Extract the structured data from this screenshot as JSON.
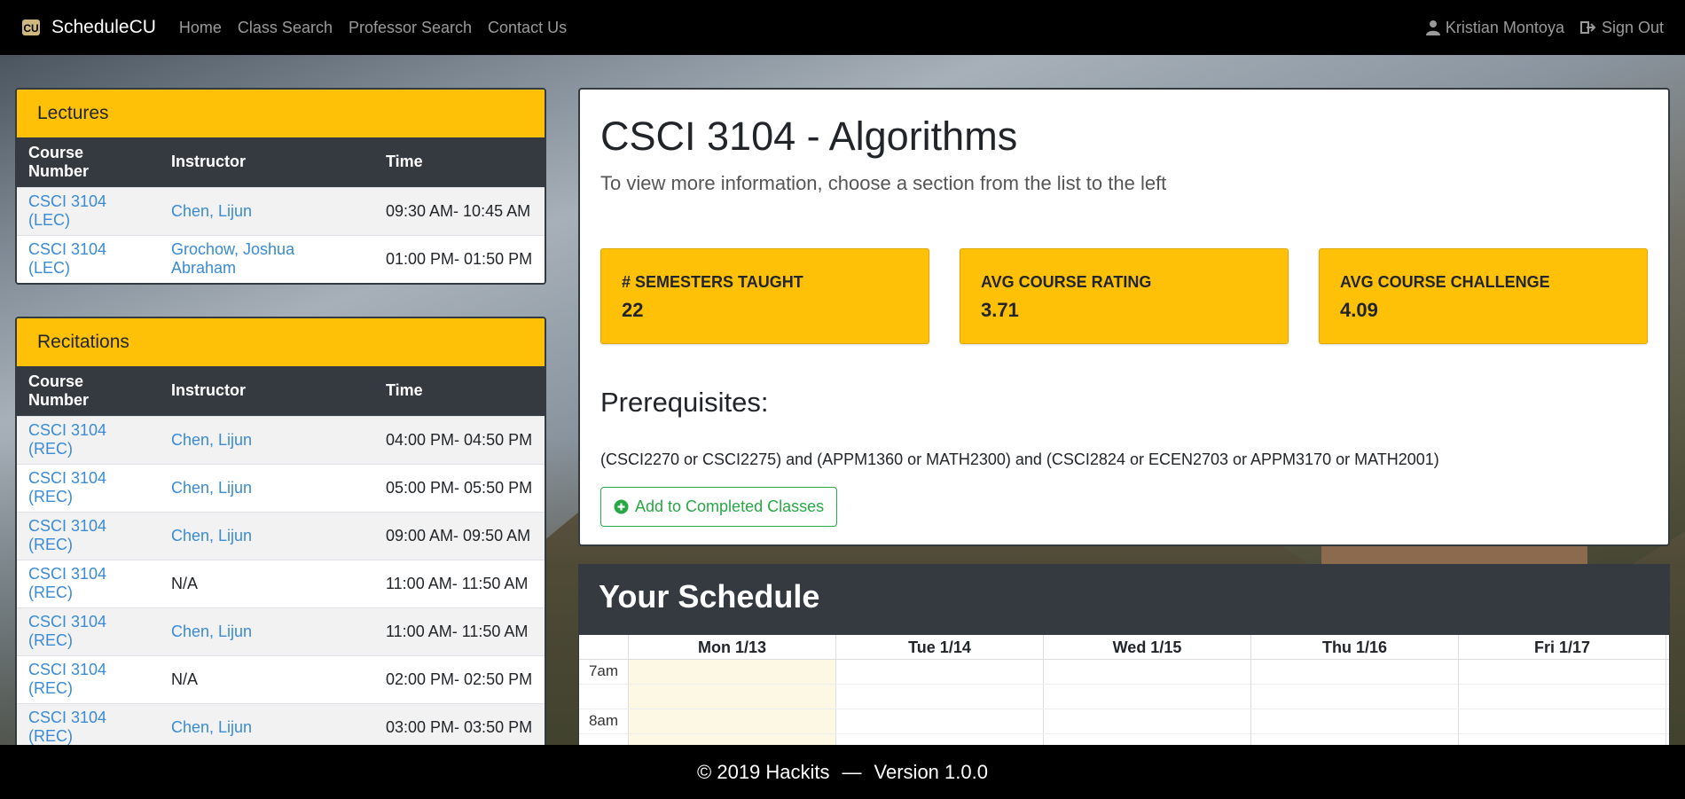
{
  "navbar": {
    "brand": "ScheduleCU",
    "links": [
      "Home",
      "Class Search",
      "Professor Search",
      "Contact Us"
    ],
    "user": "Kristian Montoya",
    "sign_out": "Sign Out"
  },
  "lectures": {
    "title": "Lectures",
    "headers": [
      "Course Number",
      "Instructor",
      "Time"
    ],
    "rows": [
      {
        "course": "CSCI 3104 (LEC)",
        "instructor": "Chen, Lijun",
        "time": "09:30 AM- 10:45 AM"
      },
      {
        "course": "CSCI 3104 (LEC)",
        "instructor": "Grochow, Joshua Abraham",
        "time": "01:00 PM- 01:50 PM"
      }
    ]
  },
  "recitations": {
    "title": "Recitations",
    "headers": [
      "Course Number",
      "Instructor",
      "Time"
    ],
    "rows": [
      {
        "course": "CSCI 3104 (REC)",
        "instructor": "Chen, Lijun",
        "time": "04:00 PM- 04:50 PM"
      },
      {
        "course": "CSCI 3104 (REC)",
        "instructor": "Chen, Lijun",
        "time": "05:00 PM- 05:50 PM"
      },
      {
        "course": "CSCI 3104 (REC)",
        "instructor": "Chen, Lijun",
        "time": "09:00 AM- 09:50 AM"
      },
      {
        "course": "CSCI 3104 (REC)",
        "instructor": "N/A",
        "time": "11:00 AM- 11:50 AM"
      },
      {
        "course": "CSCI 3104 (REC)",
        "instructor": "Chen, Lijun",
        "time": "11:00 AM- 11:50 AM"
      },
      {
        "course": "CSCI 3104 (REC)",
        "instructor": "N/A",
        "time": "02:00 PM- 02:50 PM"
      },
      {
        "course": "CSCI 3104 (REC)",
        "instructor": "Chen, Lijun",
        "time": "03:00 PM- 03:50 PM"
      }
    ]
  },
  "course": {
    "title": "CSCI 3104 - Algorithms",
    "subtitle": "To view more information, choose a section from the list to the left",
    "stats": [
      {
        "label": "# SEMESTERS TAUGHT",
        "value": "22"
      },
      {
        "label": "AVG COURSE RATING",
        "value": "3.71"
      },
      {
        "label": "AVG COURSE CHALLENGE",
        "value": "4.09"
      }
    ],
    "prereq_heading": "Prerequisites:",
    "prereq_text": "(CSCI2270 or CSCI2275) and (APPM1360 or MATH2300) and (CSCI2824 or ECEN2703 or APPM3170 or MATH2001)",
    "add_button": "Add to Completed Classes"
  },
  "schedule": {
    "title": "Your Schedule",
    "days": [
      "Mon 1/13",
      "Tue 1/14",
      "Wed 1/15",
      "Thu 1/16",
      "Fri 1/17"
    ],
    "times": [
      "7am",
      "",
      "8am",
      ""
    ]
  },
  "footer": {
    "copyright": "© 2019 Hackits",
    "separator": "—",
    "version": "Version 1.0.0"
  },
  "colors": {
    "accent": "#ffc107",
    "dark": "#343a40",
    "link": "#3a8ad6",
    "success": "#28a745"
  }
}
